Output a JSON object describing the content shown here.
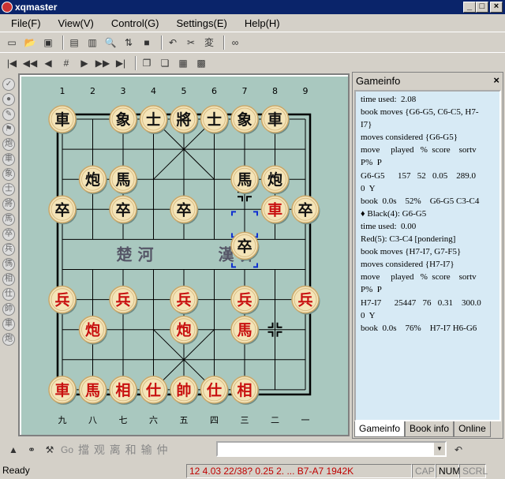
{
  "window": {
    "title": "xqmaster",
    "minimize": "_",
    "maximize": "□",
    "close": "×"
  },
  "menu": [
    "File(F)",
    "View(V)",
    "Control(G)",
    "Settings(E)",
    "Help(H)"
  ],
  "board": {
    "top_files": [
      "1",
      "2",
      "3",
      "4",
      "5",
      "6",
      "7",
      "8",
      "9"
    ],
    "bottom_files": [
      "九",
      "八",
      "七",
      "六",
      "五",
      "四",
      "三",
      "二",
      "一"
    ],
    "river_left": "楚 河",
    "river_right": "漢 界",
    "pieces": [
      {
        "ch": "車",
        "c": 0,
        "r": 0,
        "side": "black"
      },
      {
        "ch": "象",
        "c": 2,
        "r": 0,
        "side": "black"
      },
      {
        "ch": "士",
        "c": 3,
        "r": 0,
        "side": "black"
      },
      {
        "ch": "將",
        "c": 4,
        "r": 0,
        "side": "black"
      },
      {
        "ch": "士",
        "c": 5,
        "r": 0,
        "side": "black"
      },
      {
        "ch": "象",
        "c": 6,
        "r": 0,
        "side": "black"
      },
      {
        "ch": "車",
        "c": 7,
        "r": 0,
        "side": "black"
      },
      {
        "ch": "炮",
        "c": 1,
        "r": 2,
        "side": "black"
      },
      {
        "ch": "馬",
        "c": 2,
        "r": 2,
        "side": "black"
      },
      {
        "ch": "馬",
        "c": 6,
        "r": 2,
        "side": "black"
      },
      {
        "ch": "炮",
        "c": 7,
        "r": 2,
        "side": "black"
      },
      {
        "ch": "卒",
        "c": 0,
        "r": 3,
        "side": "black"
      },
      {
        "ch": "卒",
        "c": 2,
        "r": 3,
        "side": "black"
      },
      {
        "ch": "卒",
        "c": 4,
        "r": 3,
        "side": "black"
      },
      {
        "ch": "車",
        "c": 7,
        "r": 3,
        "side": "red"
      },
      {
        "ch": "卒",
        "c": 8,
        "r": 3,
        "side": "black"
      },
      {
        "ch": "卒",
        "c": 6,
        "r": 4,
        "side": "black"
      },
      {
        "ch": "兵",
        "c": 0,
        "r": 6,
        "side": "red"
      },
      {
        "ch": "兵",
        "c": 2,
        "r": 6,
        "side": "red"
      },
      {
        "ch": "兵",
        "c": 4,
        "r": 6,
        "side": "red"
      },
      {
        "ch": "兵",
        "c": 6,
        "r": 6,
        "side": "red"
      },
      {
        "ch": "兵",
        "c": 8,
        "r": 6,
        "side": "red"
      },
      {
        "ch": "炮",
        "c": 1,
        "r": 7,
        "side": "red"
      },
      {
        "ch": "炮",
        "c": 4,
        "r": 7,
        "side": "red"
      },
      {
        "ch": "馬",
        "c": 6,
        "r": 7,
        "side": "red"
      },
      {
        "ch": "車",
        "c": 0,
        "r": 9,
        "side": "red"
      },
      {
        "ch": "馬",
        "c": 1,
        "r": 9,
        "side": "red"
      },
      {
        "ch": "相",
        "c": 2,
        "r": 9,
        "side": "red"
      },
      {
        "ch": "仕",
        "c": 3,
        "r": 9,
        "side": "red"
      },
      {
        "ch": "帥",
        "c": 4,
        "r": 9,
        "side": "red"
      },
      {
        "ch": "仕",
        "c": 5,
        "r": 9,
        "side": "red"
      },
      {
        "ch": "相",
        "c": 6,
        "r": 9,
        "side": "red"
      }
    ]
  },
  "left_tools": [
    "✓",
    "●",
    "✎",
    "⚑",
    "炮",
    "車",
    "象",
    "士",
    "將",
    "馬",
    "卒",
    "兵",
    "傌",
    "相",
    "仕",
    "帥",
    "車",
    "炮"
  ],
  "gameinfo": {
    "title": "Gameinfo",
    "close": "×",
    "lines": [
      "time used:  2.08",
      "book moves {G6-G5, C6-C5, H7-",
      "I7}",
      "moves considered {G6-G5}",
      "move     played   %  score    sortv",
      "P%  P",
      "G6-G5      157   52   0.05    289.0",
      "0  Y",
      "book  0.0s    52%    G6-G5 C3-C4",
      "♦ Black(4): G6-G5",
      "time used:  0.00",
      "Red(5): C3-C4 [pondering]",
      "book moves {H7-I7, G7-F5}",
      "moves considered {H7-I7}",
      "move     played   %  score    sortv",
      "P%  P",
      "H7-I7      25447   76   0.31    300.0",
      "0  Y",
      "book  0.0s    76%    H7-I7 H6-G6"
    ],
    "tabs": [
      "Gameinfo",
      "Book info",
      "Online"
    ]
  },
  "command_bar": {
    "go": "Go",
    "chars": "擋 观 离 和 输 仲"
  },
  "status": {
    "ready": "Ready",
    "info": "12      4.03  22/38?   0.25  2. ...  B7-A7  1942K",
    "cap": "CAP",
    "num": "NUM",
    "scrl": "SCRL"
  }
}
